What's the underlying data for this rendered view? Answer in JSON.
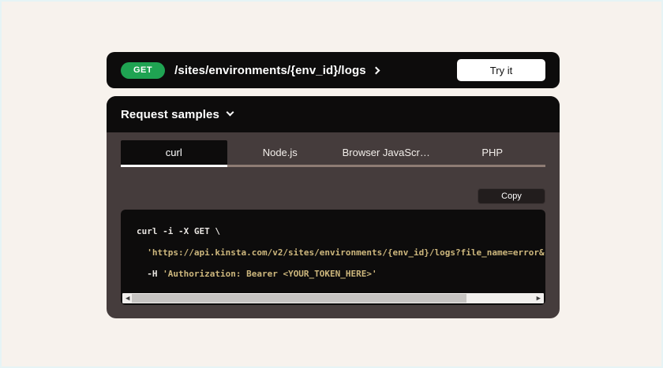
{
  "endpoint_bar": {
    "method": "GET",
    "path": "/sites/environments/{env_id}/logs",
    "try_it_label": "Try it"
  },
  "request_samples": {
    "title": "Request samples",
    "active_tab": "curl",
    "tabs": [
      {
        "label": "curl"
      },
      {
        "label": "Node.js"
      },
      {
        "label": "Browser JavaScr…"
      },
      {
        "label": "PHP"
      }
    ],
    "copy_label": "Copy",
    "code": {
      "line1": "curl -i -X GET \\",
      "line2_indent": "  ",
      "line2_string": "'https://api.kinsta.com/v2/sites/environments/{env_id}/logs?file_name=error&",
      "line3_indent": "  ",
      "line3_flag": "-H ",
      "line3_string": "'Authorization: Bearer <YOUR_TOKEN_HERE>'"
    }
  },
  "icons": {
    "path_chevron": "chevron-right",
    "samples_chevron": "chevron-down",
    "scroll_left_glyph": "◀",
    "scroll_right_glyph": "▶"
  },
  "colors": {
    "page_bg": "#f7f2ed",
    "card_black": "#0d0c0c",
    "panel_brown": "#453c3c",
    "method_green": "#1fa352",
    "try_it_bg": "#ffffff",
    "tab_underline_active": "#ffffff",
    "tab_underline_inactive": "#8e7c74",
    "code_default": "#e8e5e1",
    "code_string_gold": "#cdb77d",
    "scroll_track": "#f1efed",
    "scroll_thumb": "#c6c4c2"
  }
}
